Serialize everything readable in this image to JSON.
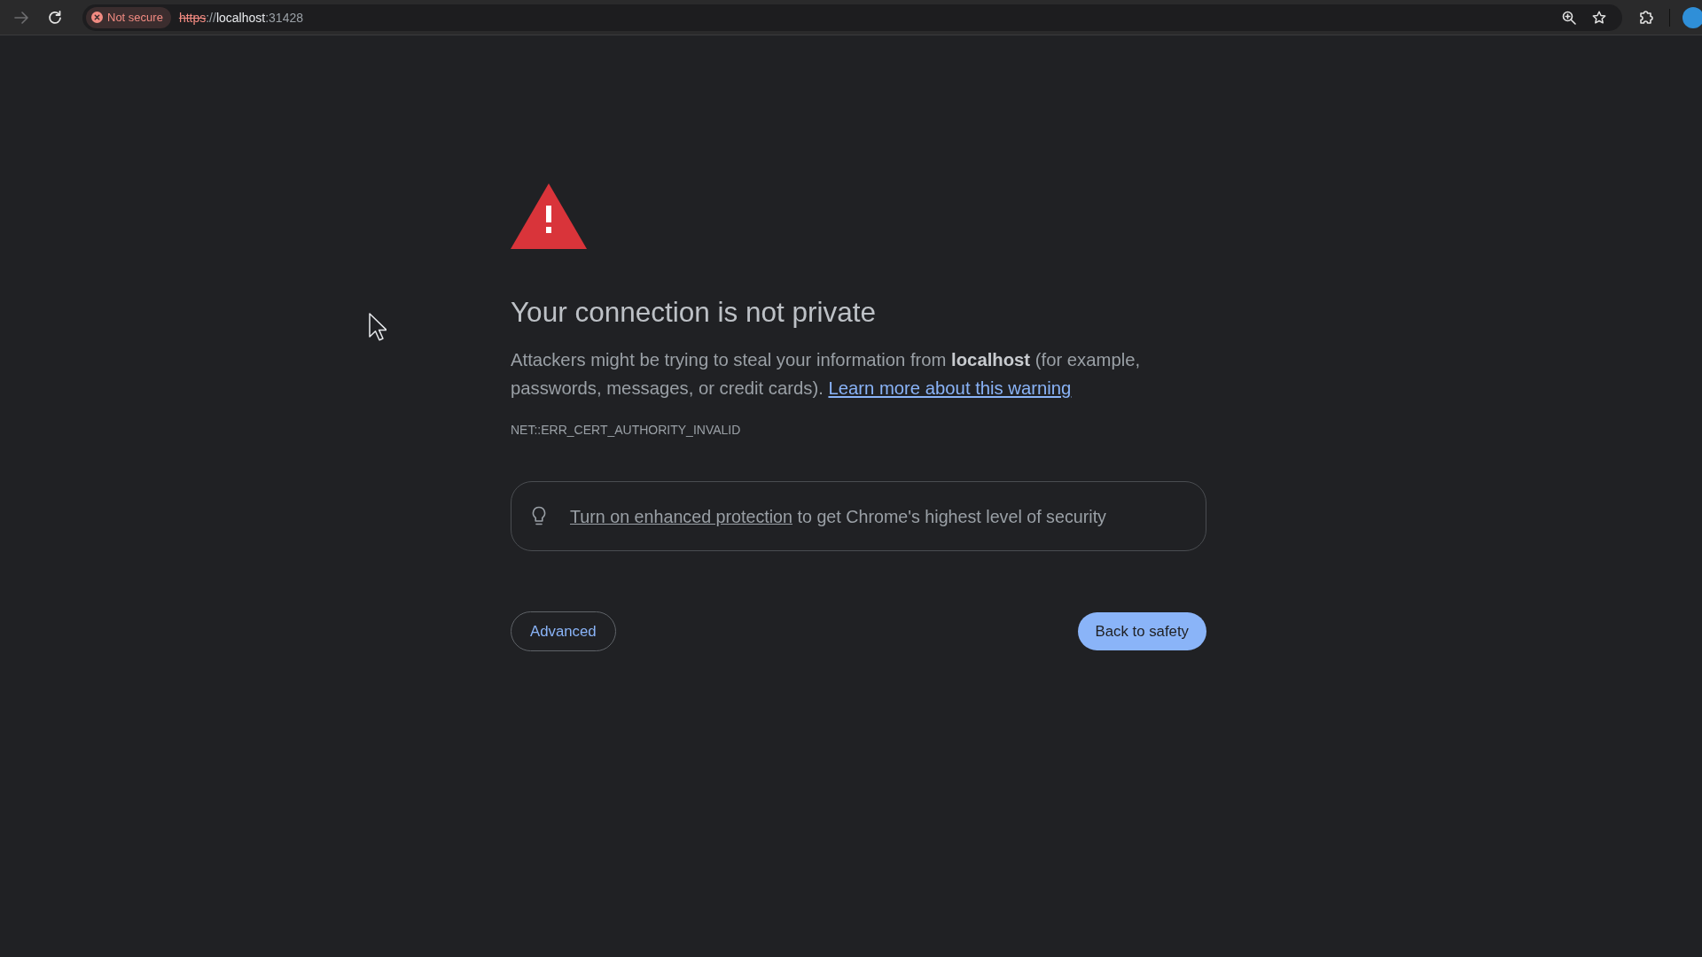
{
  "toolbar": {
    "nav_buttons": [
      {
        "kind": "forward",
        "disabled": true
      },
      {
        "kind": "reload",
        "disabled": false
      }
    ],
    "security": {
      "secure": false,
      "label": "Not secure"
    },
    "url": {
      "scheme": "https",
      "separator": "://",
      "host": "localhost",
      "port": ":31428"
    }
  },
  "interstitial": {
    "title": "Your connection is not private",
    "message": "Attackers might be trying to steal your information from **localhost** (for example, passwords, messages, or credit cards).",
    "learn_more_link": "Learn more about this warning",
    "error_code": "NET::ERR_CERT_AUTHORITY_INVALID",
    "protection_banner": {
      "link": "Turn on enhanced protection",
      "text": "to get Chrome's highest level of security"
    },
    "buttons": [
      {
        "kind": "secondary",
        "label": "Advanced"
      },
      {
        "kind": "primary",
        "label": "Back to safety"
      }
    ]
  }
}
